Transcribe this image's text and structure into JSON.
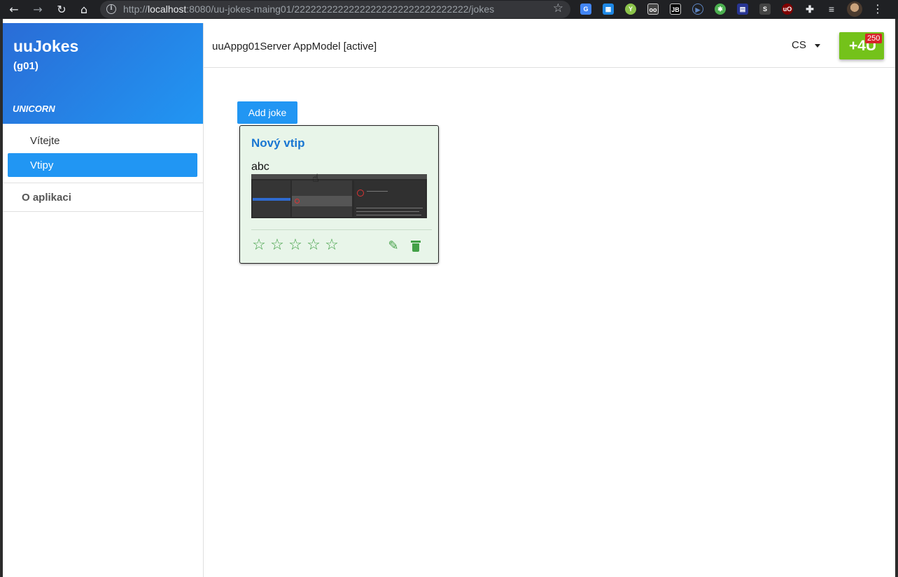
{
  "browser": {
    "url_protocol": "http://",
    "url_host": "localhost",
    "url_rest": ":8080/uu-jokes-maing01/22222222222222222222222222222222/jokes"
  },
  "sidebar": {
    "app_title": "uuJokes",
    "app_subtitle": "(g01)",
    "section_title": "UNICORN",
    "items": [
      {
        "label": "Vítejte"
      },
      {
        "label": "Vtipy"
      },
      {
        "label": "O aplikaci"
      }
    ]
  },
  "header": {
    "app_model": "uuAppg01Server AppModel [active]",
    "language": "CS",
    "plus4u_label": "+4U",
    "plus4u_badge": "250"
  },
  "main": {
    "add_joke_label": "Add joke",
    "joke": {
      "title": "Nový vtip",
      "text": "abc",
      "rating_stars": 5,
      "rating_value": 0
    }
  },
  "colors": {
    "primary": "#2196f3",
    "sidebar_header": "#2a6cd6",
    "plus4u": "#74c21a",
    "badge": "#d8232a",
    "card_bg": "#e8f5e9",
    "card_icons": "#43a047",
    "card_title": "#1976d2"
  },
  "icons": {
    "back": "arrow-left-icon",
    "forward": "arrow-right-icon",
    "reload": "reload-icon",
    "home": "home-icon",
    "edit": "pencil-icon",
    "delete": "trash-icon",
    "star": "star-outline-icon"
  }
}
